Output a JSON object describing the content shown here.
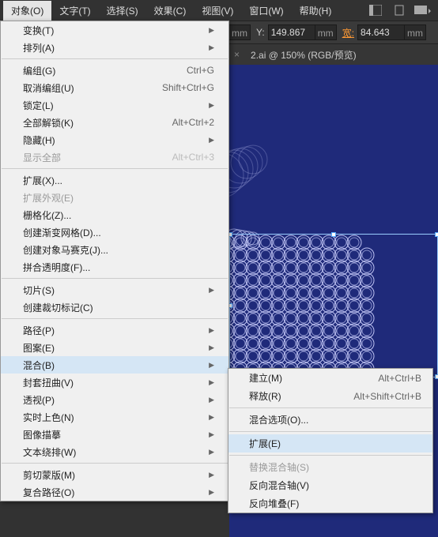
{
  "menubar": {
    "items": [
      "对象(O)",
      "文字(T)",
      "选择(S)",
      "效果(C)",
      "视图(V)",
      "窗口(W)",
      "帮助(H)"
    ],
    "active": 0
  },
  "toolbar": {
    "x_unit": "mm",
    "y_label": "Y:",
    "y_value": "149.867",
    "y_unit": "mm",
    "w_label": "宽:",
    "w_value": "84.643",
    "w_unit": "mm"
  },
  "tabs": {
    "title": "2.ai @ 150% (RGB/预览)"
  },
  "dropdown": [
    {
      "t": "row",
      "label": "变换(T)",
      "sub": true
    },
    {
      "t": "row",
      "label": "排列(A)",
      "sub": true
    },
    {
      "t": "hr"
    },
    {
      "t": "row",
      "label": "编组(G)",
      "sc": "Ctrl+G"
    },
    {
      "t": "row",
      "label": "取消编组(U)",
      "sc": "Shift+Ctrl+G"
    },
    {
      "t": "row",
      "label": "锁定(L)",
      "sub": true
    },
    {
      "t": "row",
      "label": "全部解锁(K)",
      "sc": "Alt+Ctrl+2"
    },
    {
      "t": "row",
      "label": "隐藏(H)",
      "sub": true
    },
    {
      "t": "row",
      "label": "显示全部",
      "sc": "Alt+Ctrl+3",
      "dis": true
    },
    {
      "t": "hr"
    },
    {
      "t": "row",
      "label": "扩展(X)..."
    },
    {
      "t": "row",
      "label": "扩展外观(E)",
      "dis": true
    },
    {
      "t": "row",
      "label": "栅格化(Z)..."
    },
    {
      "t": "row",
      "label": "创建渐变网格(D)..."
    },
    {
      "t": "row",
      "label": "创建对象马赛克(J)..."
    },
    {
      "t": "row",
      "label": "拼合透明度(F)..."
    },
    {
      "t": "hr"
    },
    {
      "t": "row",
      "label": "切片(S)",
      "sub": true
    },
    {
      "t": "row",
      "label": "创建裁切标记(C)"
    },
    {
      "t": "hr"
    },
    {
      "t": "row",
      "label": "路径(P)",
      "sub": true
    },
    {
      "t": "row",
      "label": "图案(E)",
      "sub": true
    },
    {
      "t": "row",
      "label": "混合(B)",
      "sub": true,
      "hl": true
    },
    {
      "t": "row",
      "label": "封套扭曲(V)",
      "sub": true
    },
    {
      "t": "row",
      "label": "透视(P)",
      "sub": true
    },
    {
      "t": "row",
      "label": "实时上色(N)",
      "sub": true
    },
    {
      "t": "row",
      "label": "图像描摹",
      "sub": true
    },
    {
      "t": "row",
      "label": "文本绕排(W)",
      "sub": true
    },
    {
      "t": "hr"
    },
    {
      "t": "row",
      "label": "剪切蒙版(M)",
      "sub": true
    },
    {
      "t": "row",
      "label": "复合路径(O)",
      "sub": true
    }
  ],
  "submenu": [
    {
      "t": "row",
      "label": "建立(M)",
      "sc": "Alt+Ctrl+B"
    },
    {
      "t": "row",
      "label": "释放(R)",
      "sc": "Alt+Shift+Ctrl+B"
    },
    {
      "t": "hr"
    },
    {
      "t": "row",
      "label": "混合选项(O)..."
    },
    {
      "t": "hr"
    },
    {
      "t": "row",
      "label": "扩展(E)",
      "hl": true
    },
    {
      "t": "hr"
    },
    {
      "t": "row",
      "label": "替换混合轴(S)",
      "dis": true
    },
    {
      "t": "row",
      "label": "反向混合轴(V)"
    },
    {
      "t": "row",
      "label": "反向堆叠(F)"
    }
  ]
}
